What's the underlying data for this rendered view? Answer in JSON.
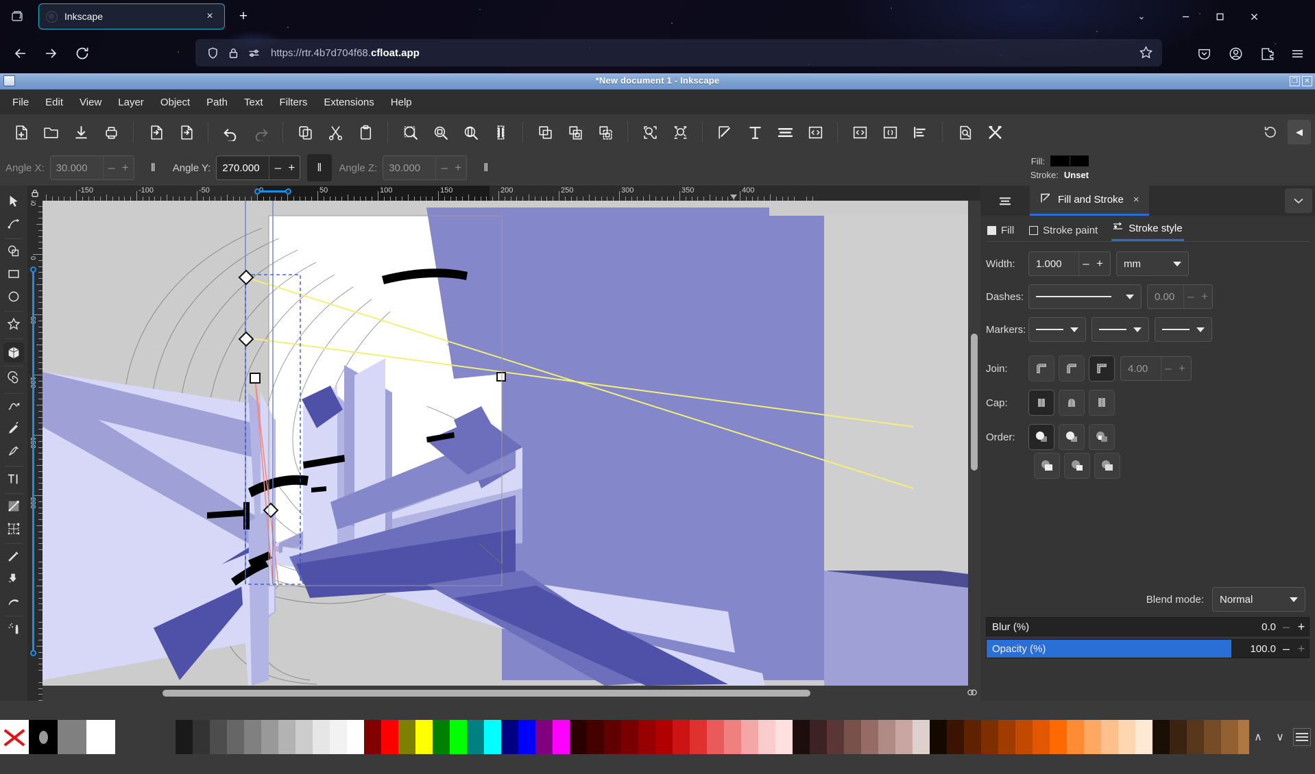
{
  "browser": {
    "tab": {
      "title": "Inkscape",
      "close": "×",
      "favicon_icon": "inkscape-favicon"
    },
    "new_tab_label": "+",
    "url": {
      "prefix": "https://rtr.4b7d704f68.",
      "domain": "cfloat.app"
    },
    "window_controls": {
      "minimize": "–",
      "maximize": "☐",
      "close": "✕"
    },
    "tab_list_dropdown": "⌄"
  },
  "inkscape": {
    "title": "*New document 1 - Inkscape",
    "titlebar_controls": {
      "restore": "❐",
      "close": "✕"
    },
    "menus": [
      "File",
      "Edit",
      "View",
      "Layer",
      "Object",
      "Path",
      "Text",
      "Filters",
      "Extensions",
      "Help"
    ],
    "command_toolbar": [
      {
        "name": "new-document-icon"
      },
      {
        "name": "open-document-icon"
      },
      {
        "name": "save-document-icon"
      },
      {
        "name": "print-document-icon"
      },
      {
        "sep": true
      },
      {
        "name": "import-icon"
      },
      {
        "name": "export-icon"
      },
      {
        "sep": true
      },
      {
        "name": "undo-icon"
      },
      {
        "name": "redo-icon",
        "dim": true
      },
      {
        "sep": true
      },
      {
        "name": "copy-icon"
      },
      {
        "name": "cut-icon"
      },
      {
        "name": "paste-icon"
      },
      {
        "sep": true
      },
      {
        "name": "zoom-selection-icon"
      },
      {
        "name": "zoom-drawing-icon"
      },
      {
        "name": "zoom-page-icon"
      },
      {
        "name": "zoom-page-width-icon"
      },
      {
        "sep": true
      },
      {
        "name": "duplicate-icon"
      },
      {
        "name": "group-icon"
      },
      {
        "name": "ungroup-icon"
      },
      {
        "sep": true
      },
      {
        "name": "clip-icon"
      },
      {
        "name": "mask-icon"
      },
      {
        "sep": true
      },
      {
        "name": "fill-and-stroke-icon"
      },
      {
        "name": "text-and-font-icon"
      },
      {
        "name": "layers-icon"
      },
      {
        "name": "xml-editor-icon"
      },
      {
        "sep": true
      },
      {
        "name": "selectors-icon"
      },
      {
        "name": "objects-panel-icon"
      },
      {
        "name": "align-distribute-icon"
      },
      {
        "sep": true
      },
      {
        "name": "document-properties-icon"
      },
      {
        "name": "preferences-icon"
      }
    ],
    "command_right": {
      "reset_icon": "reset-icon",
      "collapse_icon": "collapse-left-icon",
      "collapse_glyph": "◀"
    },
    "tool_controls": {
      "angle_x": {
        "label": "Angle X:",
        "value": "30.000",
        "minus": "–",
        "plus": "+",
        "parallel_glyph": "‖",
        "parallel_active": false,
        "active": false
      },
      "angle_y": {
        "label": "Angle Y:",
        "value": "270.000",
        "minus": "–",
        "plus": "+",
        "parallel_glyph": "‖",
        "parallel_active": true,
        "active": true
      },
      "angle_z": {
        "label": "Angle Z:",
        "value": "30.000",
        "minus": "–",
        "plus": "+",
        "parallel_glyph": "‖",
        "parallel_active": false,
        "active": false
      }
    },
    "style_indicator": {
      "fill_label": "Fill:",
      "stroke_label": "Stroke:",
      "stroke_value": "Unset",
      "fill_color": "#000000"
    },
    "toolbox": [
      {
        "name": "selector-tool",
        "glyph": "selector"
      },
      {
        "name": "node-tool",
        "glyph": "node"
      },
      {
        "sep_after": false
      },
      {
        "name": "shape-builder-tool",
        "glyph": "shapebuilder"
      },
      {
        "name": "rectangle-tool",
        "glyph": "rect"
      },
      {
        "name": "ellipse-tool",
        "glyph": "ellipse"
      },
      {
        "name": "star-tool",
        "glyph": "star"
      },
      {
        "name": "3dbox-tool",
        "glyph": "box3d",
        "active": true
      },
      {
        "name": "spiral-tool",
        "glyph": "spiral"
      },
      {
        "name": "pen-bezier-tool",
        "glyph": "pen"
      },
      {
        "name": "pencil-tool",
        "glyph": "pencil"
      },
      {
        "name": "calligraphy-tool",
        "glyph": "calligraphy"
      },
      {
        "name": "text-tool",
        "glyph": "text"
      },
      {
        "name": "gradient-tool",
        "glyph": "gradient"
      },
      {
        "name": "mesh-gradient-tool",
        "glyph": "mesh"
      },
      {
        "name": "dropper-tool",
        "glyph": "dropper"
      },
      {
        "name": "paint-bucket-tool",
        "glyph": "bucket"
      },
      {
        "name": "tweak-tool",
        "glyph": "tweak"
      },
      {
        "name": "spray-tool",
        "glyph": "spray"
      }
    ],
    "rulers": {
      "horizontal_labels": [
        "-150",
        "-100",
        "-50",
        "0",
        "50",
        "100",
        "150",
        "200",
        "250",
        "300",
        "350",
        "400"
      ],
      "vertical_labels": [
        "-50",
        "0",
        "50",
        "100",
        "150",
        "200"
      ],
      "unit": "mm"
    },
    "dock": {
      "layers_tab_icon": "layers-icon",
      "fill_stroke_tab": {
        "label": "Fill and Stroke",
        "icon": "fill-stroke-icon",
        "close": "×"
      },
      "collapse_icon": "chevron-down-icon",
      "subtabs": [
        {
          "label": "Fill",
          "name": "tab-fill",
          "selected": false
        },
        {
          "label": "Stroke paint",
          "name": "tab-stroke-paint",
          "selected": false
        },
        {
          "label": "Stroke style",
          "name": "tab-stroke-style",
          "selected": true
        }
      ],
      "stroke_style": {
        "width": {
          "label": "Width:",
          "value": "1.000",
          "minus": "–",
          "plus": "+",
          "unit": "mm"
        },
        "dashes": {
          "label": "Dashes:",
          "offset": "0.00",
          "minus": "–",
          "plus": "+"
        },
        "markers": {
          "label": "Markers:",
          "start": "none",
          "mid": "none",
          "end": "none"
        },
        "join": {
          "label": "Join:",
          "options": [
            "round-join",
            "bevel-join",
            "miter-join"
          ],
          "selected_index": 2,
          "miter_limit": "4.00",
          "minus": "–",
          "plus": "+"
        },
        "cap": {
          "label": "Cap:",
          "options": [
            "butt-cap",
            "round-cap",
            "square-cap"
          ],
          "selected_index": 0
        },
        "order": {
          "label": "Order:",
          "options": [
            "fill-stroke-markers",
            "fill-markers-stroke",
            "stroke-fill-markers",
            "stroke-markers-fill",
            "markers-fill-stroke",
            "markers-stroke-fill"
          ],
          "selected_index": 0
        }
      },
      "blend_mode": {
        "label": "Blend mode:",
        "value": "Normal"
      },
      "blur": {
        "label": "Blur (%)",
        "value": "0.0",
        "percent": 0,
        "minus": "–",
        "plus": "+"
      },
      "opacity": {
        "label": "Opacity (%)",
        "value": "100.0",
        "percent": 100,
        "minus": "–",
        "plus": "+"
      }
    },
    "palette": {
      "none_swatch": "none-color",
      "black_swatch": "#000000",
      "gray_swatch": "#808080",
      "white_swatch": "#ffffff",
      "colors": [
        "#1a1a1a",
        "#333333",
        "#4d4d4d",
        "#666666",
        "#808080",
        "#999999",
        "#b3b3b3",
        "#cccccc",
        "#e6e6e6",
        "#f2f2f2",
        "#ffffff",
        "#800000",
        "#ff0000",
        "#808000",
        "#ffff00",
        "#008000",
        "#00ff00",
        "#008080",
        "#00ffff",
        "#000080",
        "#0000ff",
        "#800080",
        "#ff00ff",
        "#2b0000",
        "#450000",
        "#600000",
        "#7a0000",
        "#960000",
        "#b00000",
        "#cc1414",
        "#e03030",
        "#ea5a5a",
        "#f08080",
        "#f6a6a6",
        "#fbcccc",
        "#ffe0e0",
        "#1e0d0d",
        "#3c2222",
        "#5a3636",
        "#78504c",
        "#966b66",
        "#b08a85",
        "#c8a6a2",
        "#ded0cd",
        "#140800",
        "#3b1400",
        "#5e2200",
        "#7d2f00",
        "#a03c00",
        "#c24900",
        "#e25800",
        "#ff6a00",
        "#ff8c33",
        "#ffa861",
        "#ffc08e",
        "#ffd6b2",
        "#ffe9d4",
        "#1a0f05",
        "#3a2411",
        "#58381b",
        "#754c26",
        "#926033",
        "#ae7744",
        "#c69262",
        "#d9ab85",
        "#e6c2a6",
        "#f0d6c2",
        "#15110e",
        "#362e28",
        "#554a40",
        "#6f6356",
        "#8a7d70",
        "#a3978c",
        "#bcb1a7",
        "#d2c9c1",
        "#e4ded9",
        "#f1eeeb"
      ],
      "scroll_up": "∧",
      "scroll_down": "∨",
      "menu_icon": "palette-menu-icon"
    }
  }
}
